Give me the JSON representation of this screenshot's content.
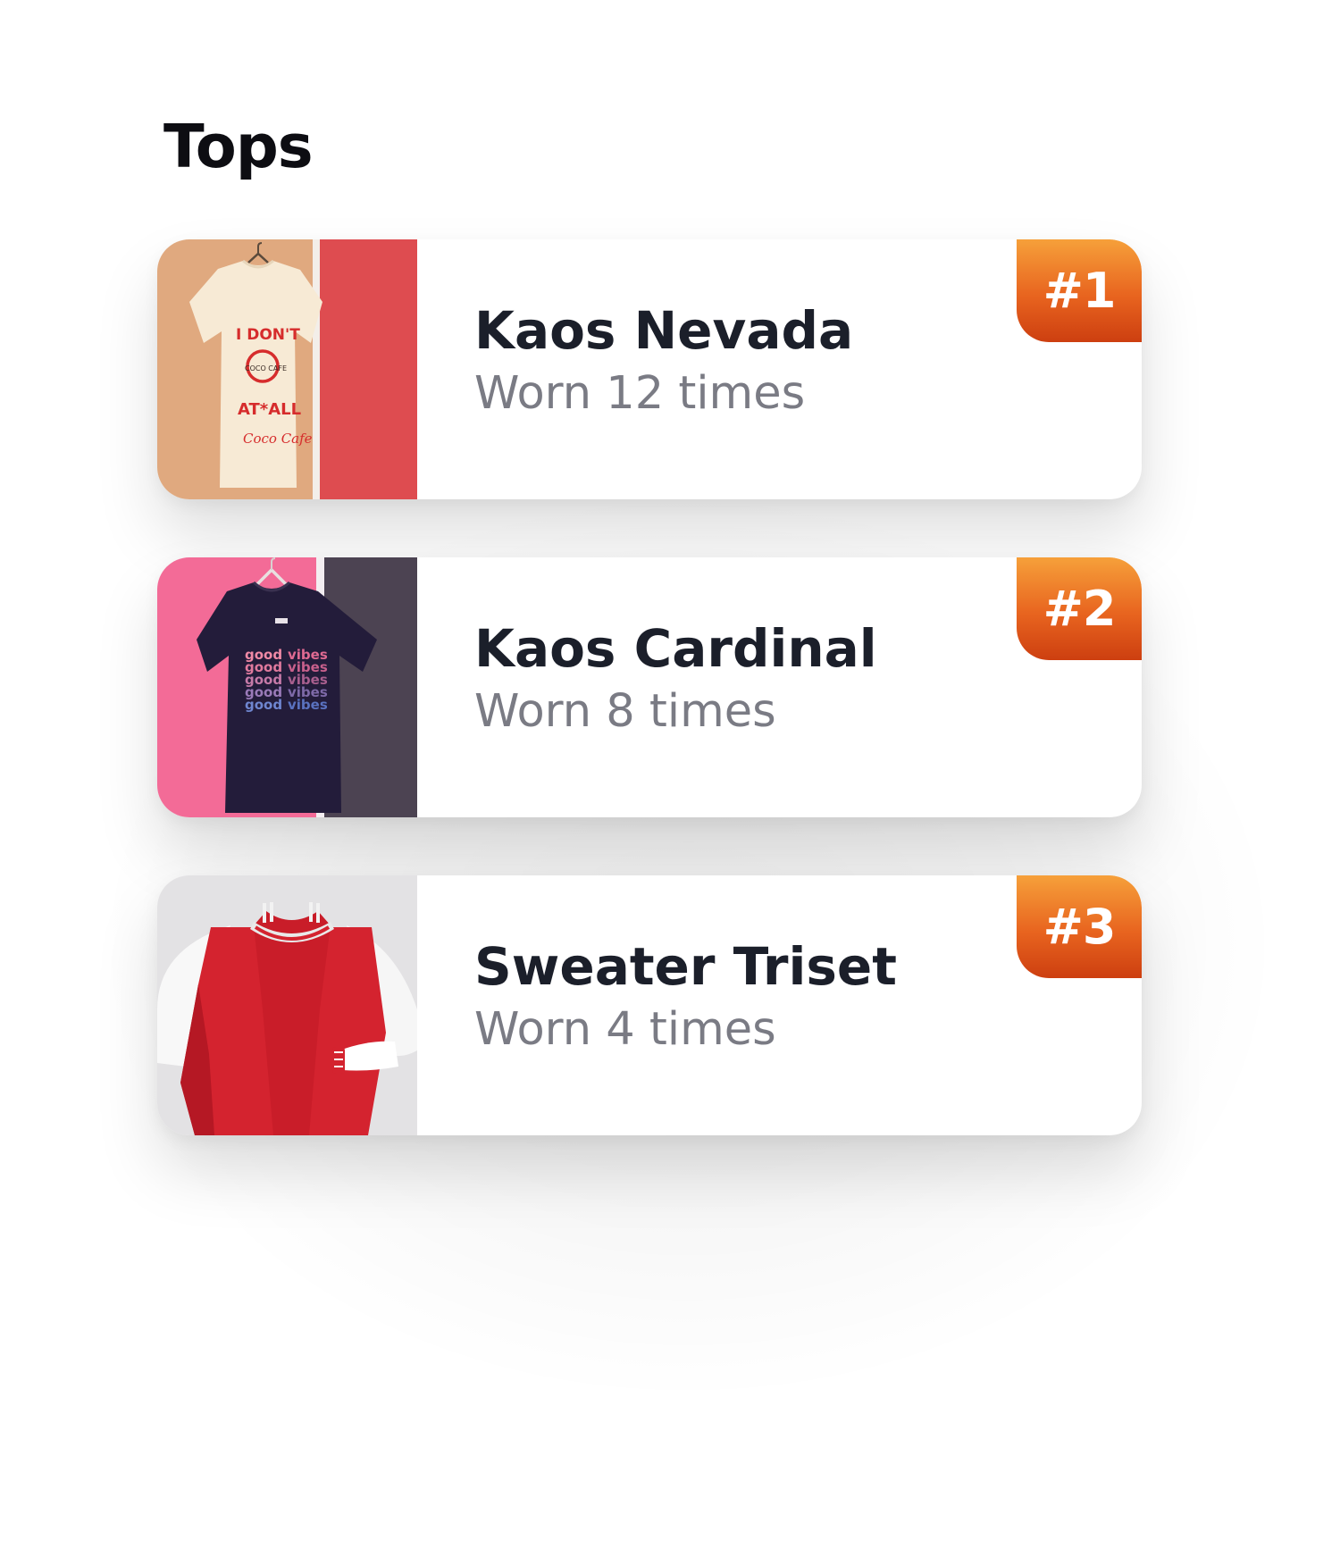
{
  "section": {
    "title": "Tops"
  },
  "items": [
    {
      "name": "Kaos Nevada",
      "worn": "Worn 12 times",
      "rank": "#1",
      "print": {
        "line1": "I DON'T",
        "logo": "COCO CAFE",
        "line3": "AT*ALL",
        "line4": "Coco Cafe"
      }
    },
    {
      "name": "Kaos Cardinal",
      "worn": "Worn 8 times",
      "rank": "#2",
      "print": {
        "word1": "good",
        "word2": "vibes"
      }
    },
    {
      "name": "Sweater Triset",
      "worn": "Worn 4 times",
      "rank": "#3"
    }
  ],
  "colors": {
    "accent_top": "#f6a03a",
    "accent_bottom": "#cd3f10",
    "title": "#0d0d12",
    "name": "#1b1f2a",
    "subtext": "#7a7b84"
  },
  "icons": [
    "tshirt-cream-photo",
    "tshirt-navy-photo",
    "varsity-jacket-photo"
  ]
}
